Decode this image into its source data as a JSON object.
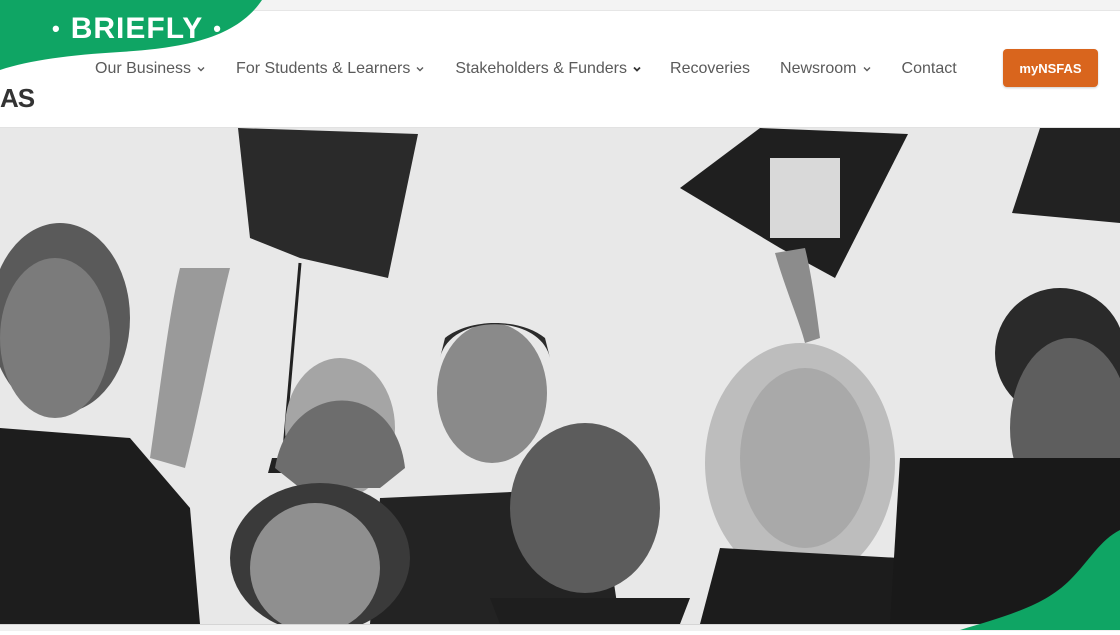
{
  "brand": {
    "name": "BRIEFLY",
    "color": "#0fa564"
  },
  "header": {
    "logo_fragment": "AS",
    "nav": [
      {
        "label": "Our Business",
        "has_dropdown": true
      },
      {
        "label": "For Students & Learners",
        "has_dropdown": true
      },
      {
        "label": "Stakeholders & Funders",
        "has_dropdown": true
      },
      {
        "label": "Recoveries",
        "has_dropdown": false
      },
      {
        "label": "Newsroom",
        "has_dropdown": true
      },
      {
        "label": "Contact",
        "has_dropdown": false
      }
    ],
    "cta_label": "myNSFAS",
    "cta_color": "#d9651d"
  },
  "hero": {
    "image": "grayscale photo of smiling graduates tossing caps"
  }
}
